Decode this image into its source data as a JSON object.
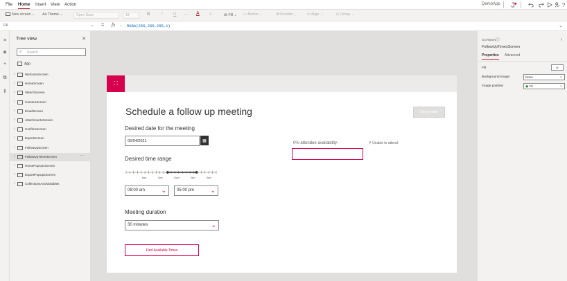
{
  "menu": {
    "items": [
      "File",
      "Home",
      "Insert",
      "View",
      "Action"
    ],
    "active": "Home",
    "app_name": "DemoApp",
    "icons": [
      "app-checker-icon",
      "undo-icon",
      "redo-icon",
      "play-icon",
      "share-user-icon",
      "help-icon"
    ]
  },
  "toolbar": {
    "new_screen": "New screen",
    "theme": "Theme",
    "font": "Open Sans",
    "font_size": "18",
    "bold": "B",
    "italic": "/",
    "underline": "U",
    "strike": "—",
    "font_color": "A",
    "align": "≡",
    "fill": "Fill",
    "border": "Border",
    "reorder": "Reorder",
    "align_menu": "Align",
    "group": "Group"
  },
  "formula": {
    "property": "Fill",
    "equals": "=",
    "fx": "fx",
    "value": "RGBA(255,255,255,1)"
  },
  "tree": {
    "title": "Tree view",
    "search_placeholder": "Search",
    "app_label": "App",
    "items": [
      {
        "label": "WelcomeScreen"
      },
      {
        "label": "HomeScreen"
      },
      {
        "label": "SketchScreen"
      },
      {
        "label": "CameraScreen"
      },
      {
        "label": "EmailScreen"
      },
      {
        "label": "AttachmentsScreen"
      },
      {
        "label": "ConfirmScreen"
      },
      {
        "label": "ExportScreen"
      },
      {
        "label": "FollowUpScreen"
      },
      {
        "label": "FollowUpTimesScreen",
        "selected": true
      },
      {
        "label": "HomePopUpsScreen"
      },
      {
        "label": "ExportPopUpsScreen"
      },
      {
        "label": "CollectionsAndVariables"
      }
    ],
    "more": "···"
  },
  "screen": {
    "title": "Schedule a follow up meeting",
    "primary_button": "Send Invite",
    "date_label": "Desired date for the meeting",
    "date_value": "06/04/2021",
    "time_label": "Desired time range",
    "slider_ticks": [
      "6am",
      "8am",
      "12pm",
      "4pm",
      "8pm"
    ],
    "slider_range": {
      "start": 0.46,
      "end": 0.78
    },
    "start_time": "08:00 am",
    "end_time": "05:00 pm",
    "duration_label": "Meeting duration",
    "duration_value": "30 minutes",
    "find_button": "Find Available Times",
    "availability_label": "0% attendee availability:",
    "unable_label": "Unable to attend:",
    "accent": "#d6004d"
  },
  "props": {
    "kind": "SCREEN",
    "name": "FollowUpTimesScreen",
    "tabs": [
      "Properties",
      "Advanced"
    ],
    "active_tab": "Properties",
    "rows": [
      {
        "label": "Fill",
        "value": "fx"
      },
      {
        "label": "Background image",
        "value": "None"
      },
      {
        "label": "Image position",
        "value": "Fit"
      }
    ]
  }
}
